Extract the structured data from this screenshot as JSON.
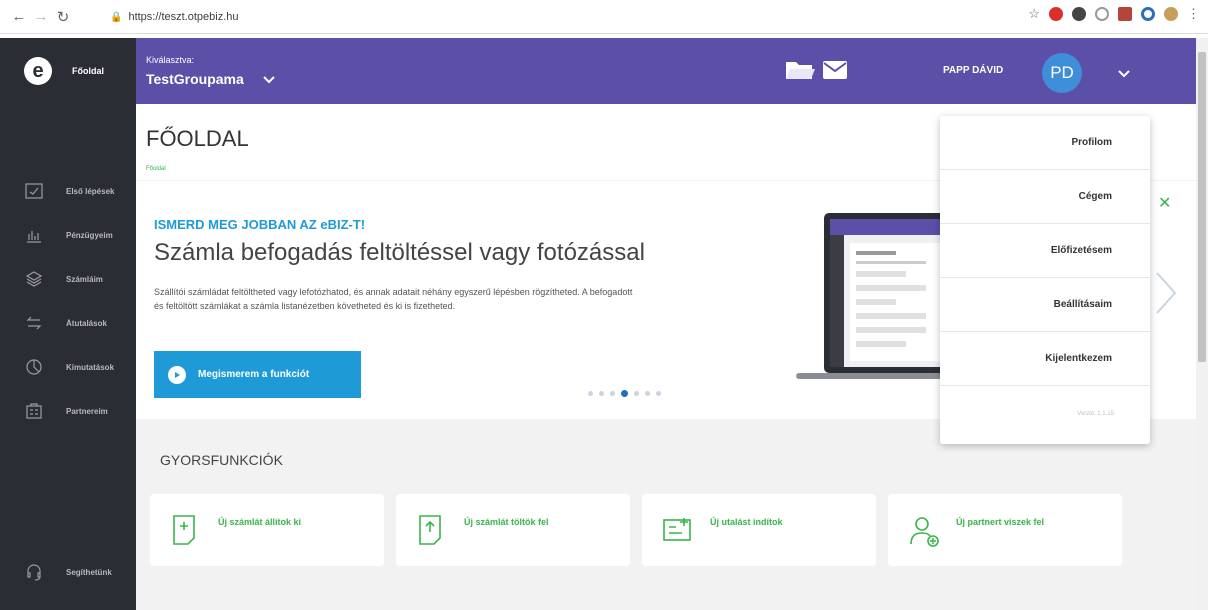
{
  "browser": {
    "url": "https://teszt.otpebiz.hu"
  },
  "sidebar": {
    "home_label": "Főoldal",
    "items": [
      {
        "label": "Első lépések",
        "icon": "checkbox-icon"
      },
      {
        "label": "Pénzügyeim",
        "icon": "bar-chart-icon"
      },
      {
        "label": "Számláim",
        "icon": "layers-icon"
      },
      {
        "label": "Átutalások",
        "icon": "transfer-icon"
      },
      {
        "label": "Kimutatások",
        "icon": "pie-chart-icon"
      },
      {
        "label": "Partnereim",
        "icon": "partners-icon"
      }
    ],
    "help_label": "Segíthetünk"
  },
  "topbar": {
    "selected_label": "Kiválasztva:",
    "selected_value": "TestGroupama",
    "user_name": "PAPP DÁVID",
    "avatar_initials": "PD"
  },
  "page": {
    "title": "FŐOLDAL",
    "breadcrumb": "Főoldal"
  },
  "banner": {
    "kicker": "ISMERD MEG JOBBAN AZ eBIZ-T!",
    "title": "Számla befogadás feltöltéssel vagy fotózással",
    "text": "Szállítói számládat feltöltheted vagy lefotózhatod, és annak adatait néhány egyszerű lépésben rögzítheted. A befogadott és feltöltött számlákat a számla listanézetben követheted és ki is fizetheted.",
    "cta_label": "Megismerem a funkciót"
  },
  "quick_functions": {
    "title": "GYORSFUNKCIÓK",
    "cards": [
      {
        "label": "Új számlát állítok ki",
        "icon": "invoice-add-icon"
      },
      {
        "label": "Új számlát töltök fel",
        "icon": "invoice-upload-icon"
      },
      {
        "label": "Új utalást indítok",
        "icon": "transfer-new-icon"
      },
      {
        "label": "Új partnert viszek fel",
        "icon": "partner-add-icon"
      }
    ]
  },
  "user_menu": {
    "items": [
      "Profilom",
      "Cégem",
      "Előfizetésem",
      "Beállításaim",
      "Kijelentkezem"
    ],
    "version": "Verzió: 1.1.15"
  },
  "colors": {
    "topbar": "#5b4fa8",
    "sidebar": "#2a2d33",
    "accent_blue": "#1e9bd7",
    "accent_green": "#39b54a",
    "avatar": "#3f8fd8"
  }
}
